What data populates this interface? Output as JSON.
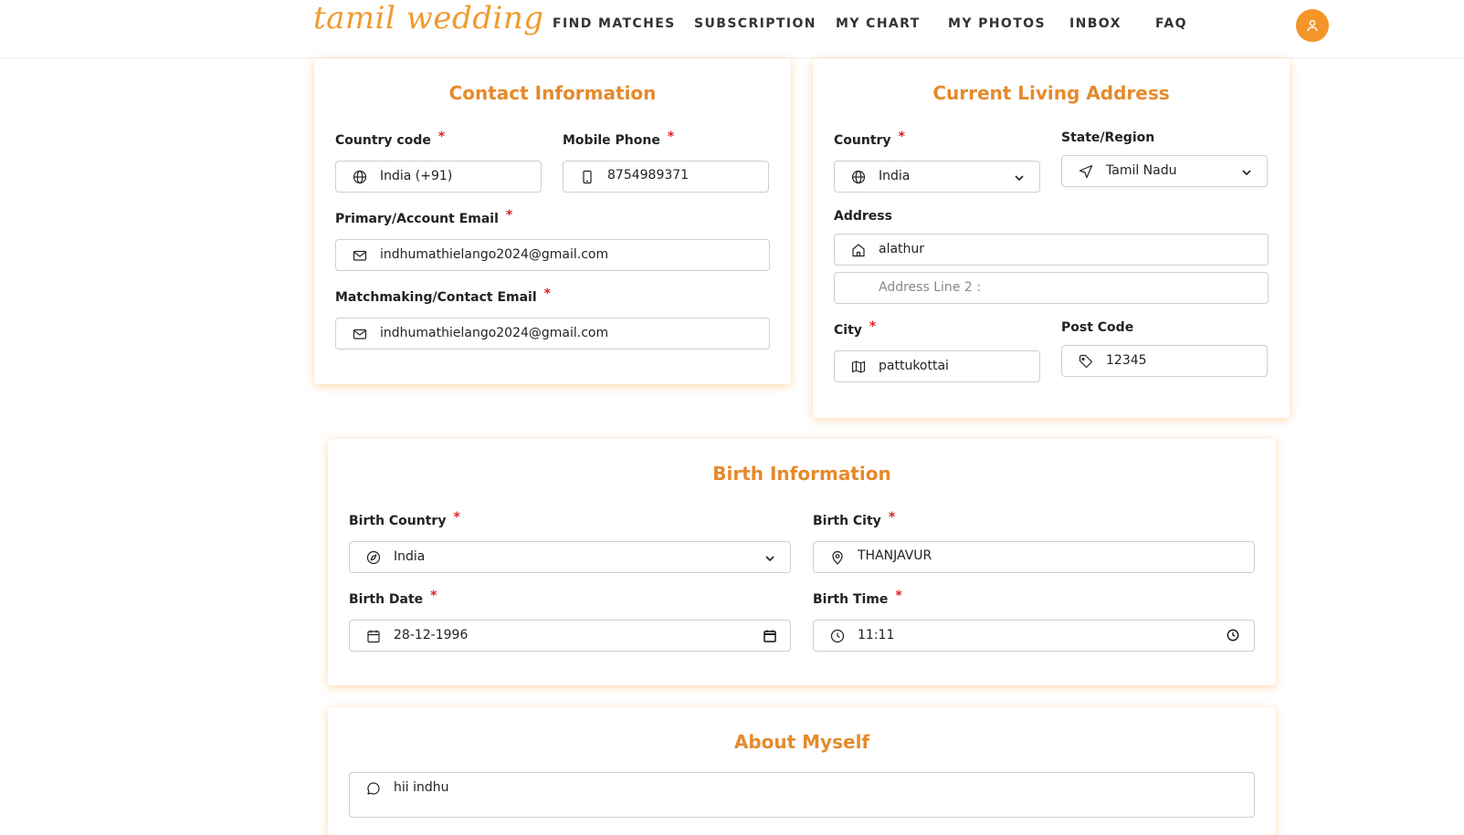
{
  "header": {
    "logo": "tamil wedding",
    "nav": [
      "FIND MATCHES",
      "SUBSCRIPTION",
      "MY CHART",
      "MY PHOTOS",
      "INBOX",
      "FAQ"
    ]
  },
  "contact": {
    "title": "Contact Information",
    "country_code_label": "Country code",
    "country_code_value": "India (+91)",
    "mobile_label": "Mobile Phone",
    "mobile_value": "8754989371",
    "primary_email_label": "Primary/Account Email",
    "primary_email_value": "indhumathielango2024@gmail.com",
    "contact_email_label": "Matchmaking/Contact Email",
    "contact_email_value": "indhumathielango2024@gmail.com"
  },
  "address": {
    "title": "Current Living Address",
    "country_label": "Country",
    "country_value": "India",
    "state_label": "State/Region",
    "state_value": "Tamil Nadu",
    "address_label": "Address",
    "address_line1": "alathur",
    "address_line2_placeholder": "Address Line 2 :",
    "city_label": "City",
    "city_value": "pattukottai",
    "postcode_label": "Post Code",
    "postcode_value": "12345"
  },
  "birth": {
    "title": "Birth Information",
    "country_label": "Birth Country",
    "country_value": "India",
    "city_label": "Birth City",
    "city_value": "THANJAVUR",
    "date_label": "Birth Date",
    "date_value": "28-12-1996",
    "time_label": "Birth Time",
    "time_value": "11:11"
  },
  "about": {
    "title": "About Myself",
    "value": "hii indhu"
  },
  "colors": {
    "accent": "#f4952a",
    "title": "#e58a2c",
    "required": "#e02020"
  },
  "required_marker": "*"
}
